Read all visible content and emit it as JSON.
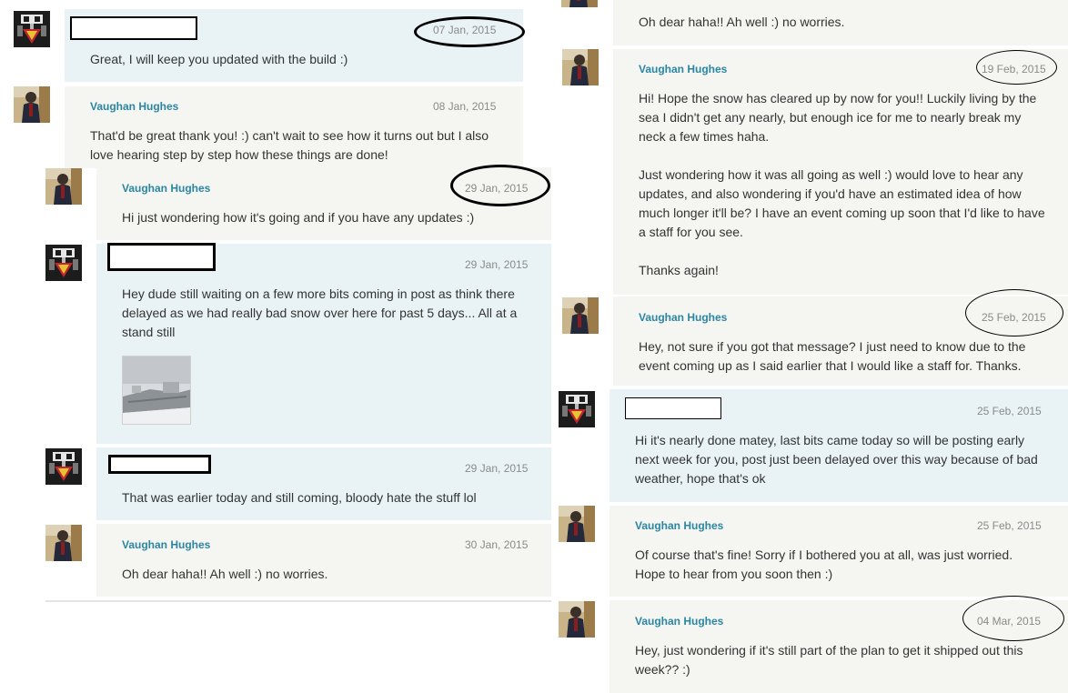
{
  "left_column": [
    {
      "author": "",
      "date": "07 Jan, 2015",
      "text": "Great, I will keep you updated with the build :)"
    },
    {
      "author": "Vaughan Hughes",
      "date": "08 Jan, 2015",
      "text": "That'd be great thank you! :) can't wait to see how it turns out but I also love hearing step by step how these things are done!"
    },
    {
      "author": "Vaughan Hughes",
      "date": "29 Jan, 2015",
      "text": "Hi just wondering how it's going and if you have any updates :)"
    },
    {
      "author": "",
      "date": "29 Jan, 2015",
      "text": "Hey dude still waiting on a few more bits coming in post as think there delayed as we had really bad snow over here for past 5 days... All at a stand still",
      "attachment": "snow-photo"
    },
    {
      "author": "",
      "date": "29 Jan, 2015",
      "text": "That was earlier today and still coming, bloody hate the stuff lol"
    },
    {
      "author": "Vaughan Hughes",
      "date": "30 Jan, 2015",
      "text": "Oh dear haha!! Ah well :) no worries."
    }
  ],
  "right_column": [
    {
      "author": "",
      "date": "",
      "text": "Oh dear haha!! Ah well :) no worries."
    },
    {
      "author": "Vaughan Hughes",
      "date": "19 Feb, 2015",
      "text": "Hi! Hope the snow has cleared up by now for you!! Luckily living by the sea I didn't get any nearly, but enough ice for me to nearly break my neck a few times haha.\n\nJust wondering how it was all going as well :) would love to hear any updates, and also wondering if you'd have an estimated idea of how much longer it'll be? I have an event coming up soon that I'd like to have a staff for you see.\n\nThanks again!"
    },
    {
      "author": "Vaughan Hughes",
      "date": "25 Feb, 2015",
      "text": "Hey, not sure if you got that message? I just need to know due to the event coming up as I said earlier that I would like a staff for. Thanks."
    },
    {
      "author": "",
      "date": "25 Feb, 2015",
      "text": "Hi it's nearly done matey, last bits came today so will be posting early next week for you, post just been delayed over this way because of bad weather, hope that's ok"
    },
    {
      "author": "Vaughan Hughes",
      "date": "25 Feb, 2015",
      "text": "Of course that's fine! Sorry if I bothered you at all, was just worried. Hope to hear from you soon then :)"
    },
    {
      "author": "Vaughan Hughes",
      "date": "04 Mar, 2015",
      "text": "Hey, just wondering if it's still part of the plan to get it shipped out this week?? :)"
    }
  ],
  "colors": {
    "name": "#2a86a3",
    "other_bg": "#e9f3f6",
    "me_bg": "#f5f5f2",
    "date": "#8a8a8a",
    "annotation": "#000000"
  }
}
